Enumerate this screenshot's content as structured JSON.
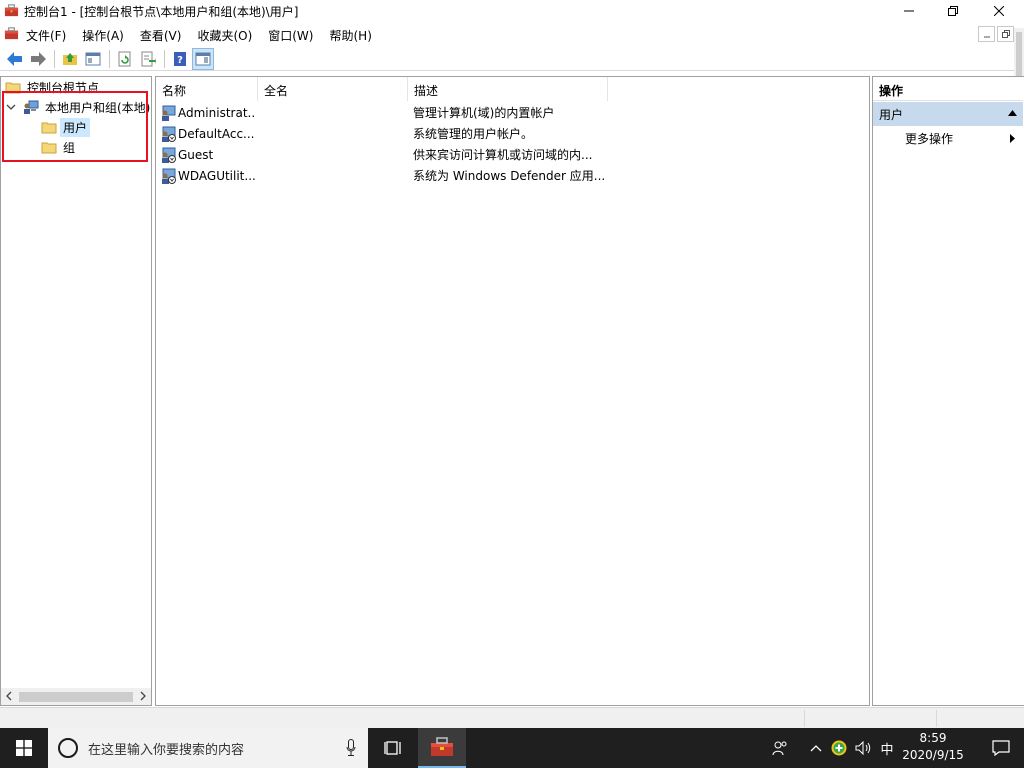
{
  "window": {
    "title": "控制台1 - [控制台根节点\\本地用户和组(本地)\\用户]"
  },
  "menu": {
    "items": [
      {
        "label": "文件(F)"
      },
      {
        "label": "操作(A)"
      },
      {
        "label": "查看(V)"
      },
      {
        "label": "收藏夹(O)"
      },
      {
        "label": "窗口(W)"
      },
      {
        "label": "帮助(H)"
      }
    ]
  },
  "toolbar": {
    "icons": [
      "back-arrow-icon",
      "forward-arrow-icon",
      "up-folder-icon",
      "show-hide-tree-icon",
      "refresh-icon",
      "export-list-icon",
      "help-icon",
      "show-hide-action-pane-icon"
    ]
  },
  "tree": {
    "root": "控制台根节点",
    "node": "本地用户和组(本地)",
    "children": [
      {
        "label": "用户",
        "selected": true
      },
      {
        "label": "组",
        "selected": false
      }
    ]
  },
  "list": {
    "columns": [
      "名称",
      "全名",
      "描述"
    ],
    "rows": [
      {
        "name": "Administrat...",
        "fullname": "",
        "description": "管理计算机(域)的内置帐户"
      },
      {
        "name": "DefaultAcc...",
        "fullname": "",
        "description": "系统管理的用户帐户。"
      },
      {
        "name": "Guest",
        "fullname": "",
        "description": "供来宾访问计算机或访问域的内..."
      },
      {
        "name": "WDAGUtilit...",
        "fullname": "",
        "description": "系统为 Windows Defender 应用..."
      }
    ]
  },
  "actions": {
    "title": "操作",
    "group": "用户",
    "item": "更多操作"
  },
  "taskbar": {
    "search_placeholder": "在这里输入你要搜索的内容",
    "ime": "中",
    "time": "8:59",
    "date": "2020/9/15"
  },
  "colors": {
    "selection": "#cce8ff",
    "action_header": "#c7d9ec",
    "highlight_box": "#e81123",
    "taskbar": "#1f1f1f"
  }
}
